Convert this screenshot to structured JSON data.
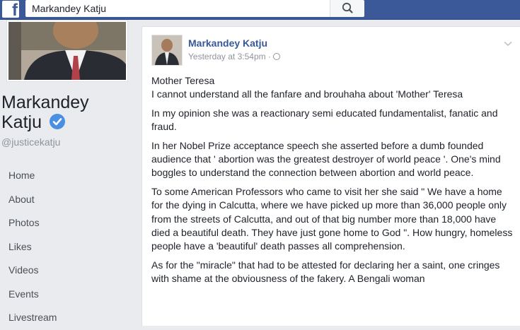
{
  "topbar": {
    "logo_letter": "f",
    "search_value": "Markandey Katju"
  },
  "sidebar": {
    "page_name_line1": "Markandey",
    "page_name_line2": "Katju",
    "handle": "@justicekatju",
    "nav": [
      "Home",
      "About",
      "Photos",
      "Likes",
      "Videos",
      "Events",
      "Livestream"
    ]
  },
  "post": {
    "author": "Markandey Katju",
    "timestamp": "Yesterday at 3:54pm ·",
    "paragraphs": [
      [
        "Mother Teresa",
        "I cannot understand all the fanfare and brouhaha about 'Mother' Teresa"
      ],
      [
        "In my opinion she was a reactionary semi educated fundamentalist, fanatic and fraud."
      ],
      [
        "In her Nobel Prize acceptance speech she asserted before a dumb founded audience that ' abortion was the greatest destroyer of world peace '. One's mind boggles to understand the connection between abortion and world peace."
      ],
      [
        "To some American Professors who came to visit her she said \" We have a home for the dying in Calcutta, where we have picked up more than 36,000 people only from the streets of Calcutta, and out of that big number more than 18,000 have died a beautiful death. They have just gone home to God \". How hungry, homeless people have a 'beautiful' death passes all comprehension."
      ],
      [
        "As for the \"miracle\" that had to be attested for declaring her a saint, one cringes with shame at the obviousness of the fakery. A Bengali woman"
      ]
    ]
  },
  "colors": {
    "topbar_bg": "#3b5998",
    "link": "#365899",
    "verified": "#4a90e2",
    "page_bg": "#e9ebee"
  },
  "icons": [
    "facebook-logo-icon",
    "search-icon",
    "verified-badge-icon",
    "globe-icon",
    "chevron-down-icon"
  ]
}
